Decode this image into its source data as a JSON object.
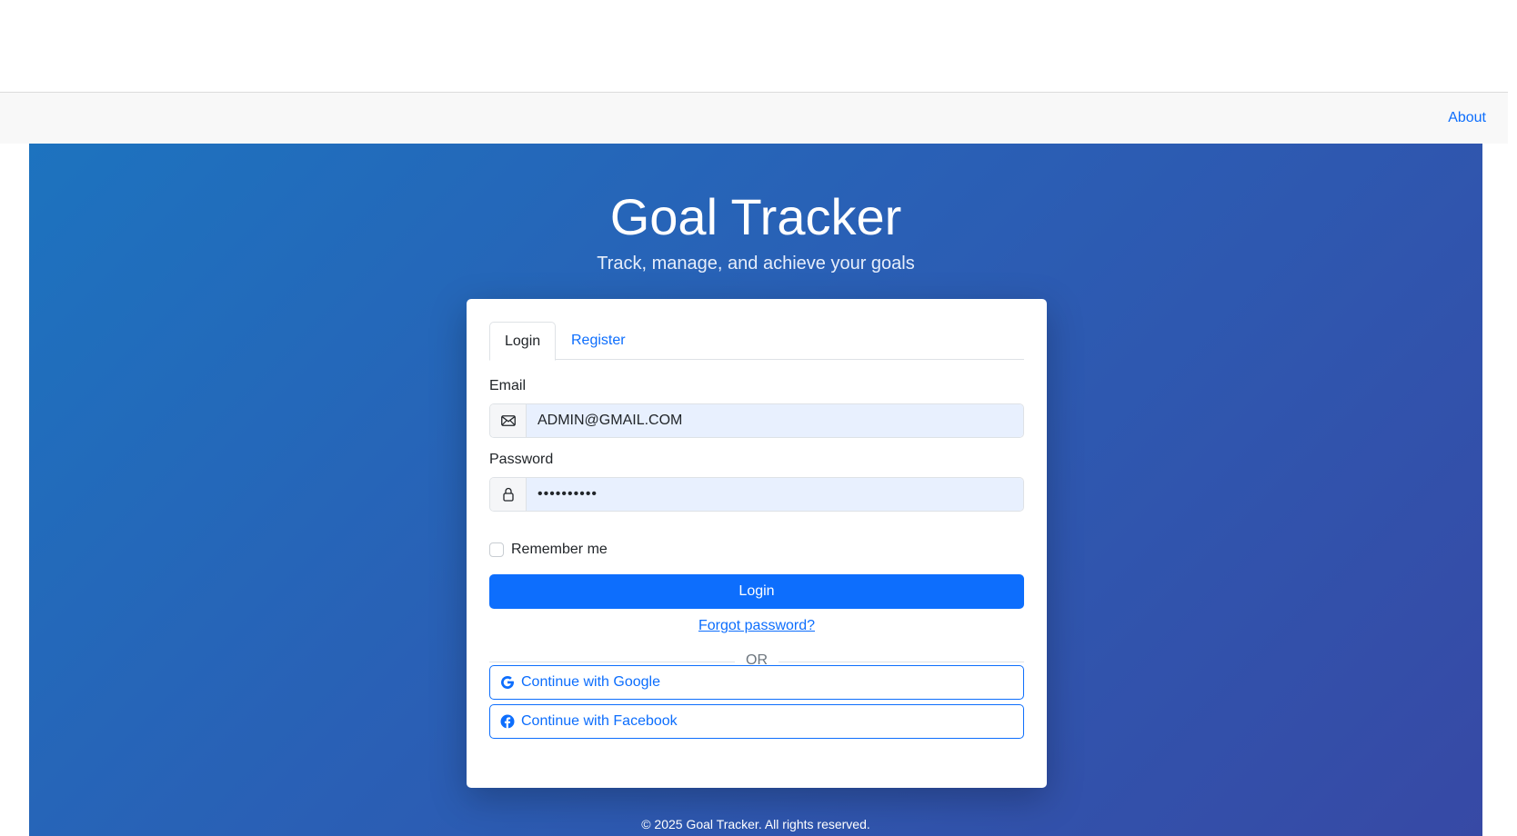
{
  "nav": {
    "about_label": "About"
  },
  "hero": {
    "title": "Goal Tracker",
    "subtitle": "Track, manage, and achieve your goals"
  },
  "auth": {
    "tabs": [
      {
        "label": "Login",
        "active": true
      },
      {
        "label": "Register",
        "active": false
      }
    ],
    "email": {
      "label": "Email",
      "value": "ADMIN@GMAIL.COM",
      "icon": "envelope-icon"
    },
    "password": {
      "label": "Password",
      "value": "••••••••••",
      "icon": "lock-icon"
    },
    "remember_label": "Remember me",
    "login_button": "Login",
    "forgot_label": "Forgot password?",
    "divider_label": "OR",
    "google_button": "Continue with Google",
    "facebook_button": "Continue with Facebook"
  },
  "footer": {
    "text": "© 2025 Goal Tracker. All rights reserved."
  },
  "colors": {
    "primary": "#0d6efd",
    "hero_gradient_start": "#1d73bf",
    "hero_gradient_end": "#3749a5",
    "input_bg": "#e8f0fe"
  }
}
